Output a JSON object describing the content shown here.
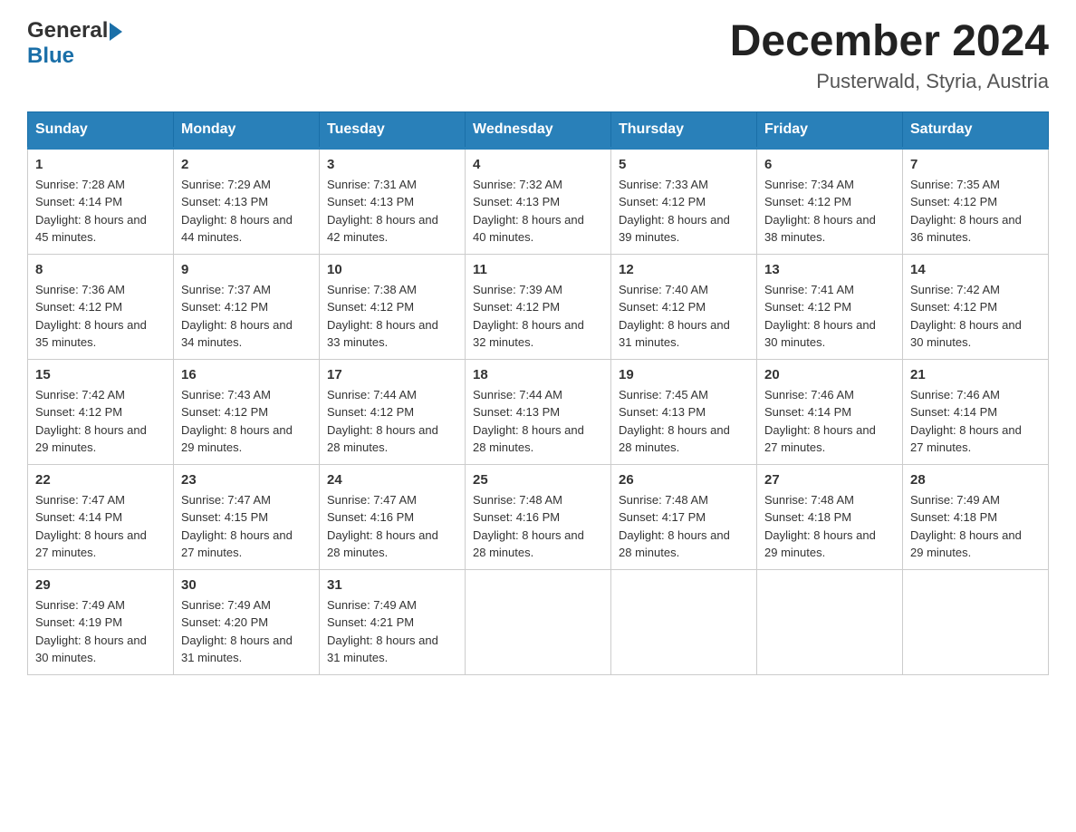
{
  "header": {
    "month_title": "December 2024",
    "location": "Pusterwald, Styria, Austria",
    "logo_general": "General",
    "logo_blue": "Blue"
  },
  "days_of_week": [
    "Sunday",
    "Monday",
    "Tuesday",
    "Wednesday",
    "Thursday",
    "Friday",
    "Saturday"
  ],
  "weeks": [
    [
      {
        "day": "1",
        "sunrise": "Sunrise: 7:28 AM",
        "sunset": "Sunset: 4:14 PM",
        "daylight": "Daylight: 8 hours and 45 minutes."
      },
      {
        "day": "2",
        "sunrise": "Sunrise: 7:29 AM",
        "sunset": "Sunset: 4:13 PM",
        "daylight": "Daylight: 8 hours and 44 minutes."
      },
      {
        "day": "3",
        "sunrise": "Sunrise: 7:31 AM",
        "sunset": "Sunset: 4:13 PM",
        "daylight": "Daylight: 8 hours and 42 minutes."
      },
      {
        "day": "4",
        "sunrise": "Sunrise: 7:32 AM",
        "sunset": "Sunset: 4:13 PM",
        "daylight": "Daylight: 8 hours and 40 minutes."
      },
      {
        "day": "5",
        "sunrise": "Sunrise: 7:33 AM",
        "sunset": "Sunset: 4:12 PM",
        "daylight": "Daylight: 8 hours and 39 minutes."
      },
      {
        "day": "6",
        "sunrise": "Sunrise: 7:34 AM",
        "sunset": "Sunset: 4:12 PM",
        "daylight": "Daylight: 8 hours and 38 minutes."
      },
      {
        "day": "7",
        "sunrise": "Sunrise: 7:35 AM",
        "sunset": "Sunset: 4:12 PM",
        "daylight": "Daylight: 8 hours and 36 minutes."
      }
    ],
    [
      {
        "day": "8",
        "sunrise": "Sunrise: 7:36 AM",
        "sunset": "Sunset: 4:12 PM",
        "daylight": "Daylight: 8 hours and 35 minutes."
      },
      {
        "day": "9",
        "sunrise": "Sunrise: 7:37 AM",
        "sunset": "Sunset: 4:12 PM",
        "daylight": "Daylight: 8 hours and 34 minutes."
      },
      {
        "day": "10",
        "sunrise": "Sunrise: 7:38 AM",
        "sunset": "Sunset: 4:12 PM",
        "daylight": "Daylight: 8 hours and 33 minutes."
      },
      {
        "day": "11",
        "sunrise": "Sunrise: 7:39 AM",
        "sunset": "Sunset: 4:12 PM",
        "daylight": "Daylight: 8 hours and 32 minutes."
      },
      {
        "day": "12",
        "sunrise": "Sunrise: 7:40 AM",
        "sunset": "Sunset: 4:12 PM",
        "daylight": "Daylight: 8 hours and 31 minutes."
      },
      {
        "day": "13",
        "sunrise": "Sunrise: 7:41 AM",
        "sunset": "Sunset: 4:12 PM",
        "daylight": "Daylight: 8 hours and 30 minutes."
      },
      {
        "day": "14",
        "sunrise": "Sunrise: 7:42 AM",
        "sunset": "Sunset: 4:12 PM",
        "daylight": "Daylight: 8 hours and 30 minutes."
      }
    ],
    [
      {
        "day": "15",
        "sunrise": "Sunrise: 7:42 AM",
        "sunset": "Sunset: 4:12 PM",
        "daylight": "Daylight: 8 hours and 29 minutes."
      },
      {
        "day": "16",
        "sunrise": "Sunrise: 7:43 AM",
        "sunset": "Sunset: 4:12 PM",
        "daylight": "Daylight: 8 hours and 29 minutes."
      },
      {
        "day": "17",
        "sunrise": "Sunrise: 7:44 AM",
        "sunset": "Sunset: 4:12 PM",
        "daylight": "Daylight: 8 hours and 28 minutes."
      },
      {
        "day": "18",
        "sunrise": "Sunrise: 7:44 AM",
        "sunset": "Sunset: 4:13 PM",
        "daylight": "Daylight: 8 hours and 28 minutes."
      },
      {
        "day": "19",
        "sunrise": "Sunrise: 7:45 AM",
        "sunset": "Sunset: 4:13 PM",
        "daylight": "Daylight: 8 hours and 28 minutes."
      },
      {
        "day": "20",
        "sunrise": "Sunrise: 7:46 AM",
        "sunset": "Sunset: 4:14 PM",
        "daylight": "Daylight: 8 hours and 27 minutes."
      },
      {
        "day": "21",
        "sunrise": "Sunrise: 7:46 AM",
        "sunset": "Sunset: 4:14 PM",
        "daylight": "Daylight: 8 hours and 27 minutes."
      }
    ],
    [
      {
        "day": "22",
        "sunrise": "Sunrise: 7:47 AM",
        "sunset": "Sunset: 4:14 PM",
        "daylight": "Daylight: 8 hours and 27 minutes."
      },
      {
        "day": "23",
        "sunrise": "Sunrise: 7:47 AM",
        "sunset": "Sunset: 4:15 PM",
        "daylight": "Daylight: 8 hours and 27 minutes."
      },
      {
        "day": "24",
        "sunrise": "Sunrise: 7:47 AM",
        "sunset": "Sunset: 4:16 PM",
        "daylight": "Daylight: 8 hours and 28 minutes."
      },
      {
        "day": "25",
        "sunrise": "Sunrise: 7:48 AM",
        "sunset": "Sunset: 4:16 PM",
        "daylight": "Daylight: 8 hours and 28 minutes."
      },
      {
        "day": "26",
        "sunrise": "Sunrise: 7:48 AM",
        "sunset": "Sunset: 4:17 PM",
        "daylight": "Daylight: 8 hours and 28 minutes."
      },
      {
        "day": "27",
        "sunrise": "Sunrise: 7:48 AM",
        "sunset": "Sunset: 4:18 PM",
        "daylight": "Daylight: 8 hours and 29 minutes."
      },
      {
        "day": "28",
        "sunrise": "Sunrise: 7:49 AM",
        "sunset": "Sunset: 4:18 PM",
        "daylight": "Daylight: 8 hours and 29 minutes."
      }
    ],
    [
      {
        "day": "29",
        "sunrise": "Sunrise: 7:49 AM",
        "sunset": "Sunset: 4:19 PM",
        "daylight": "Daylight: 8 hours and 30 minutes."
      },
      {
        "day": "30",
        "sunrise": "Sunrise: 7:49 AM",
        "sunset": "Sunset: 4:20 PM",
        "daylight": "Daylight: 8 hours and 31 minutes."
      },
      {
        "day": "31",
        "sunrise": "Sunrise: 7:49 AM",
        "sunset": "Sunset: 4:21 PM",
        "daylight": "Daylight: 8 hours and 31 minutes."
      },
      null,
      null,
      null,
      null
    ]
  ]
}
